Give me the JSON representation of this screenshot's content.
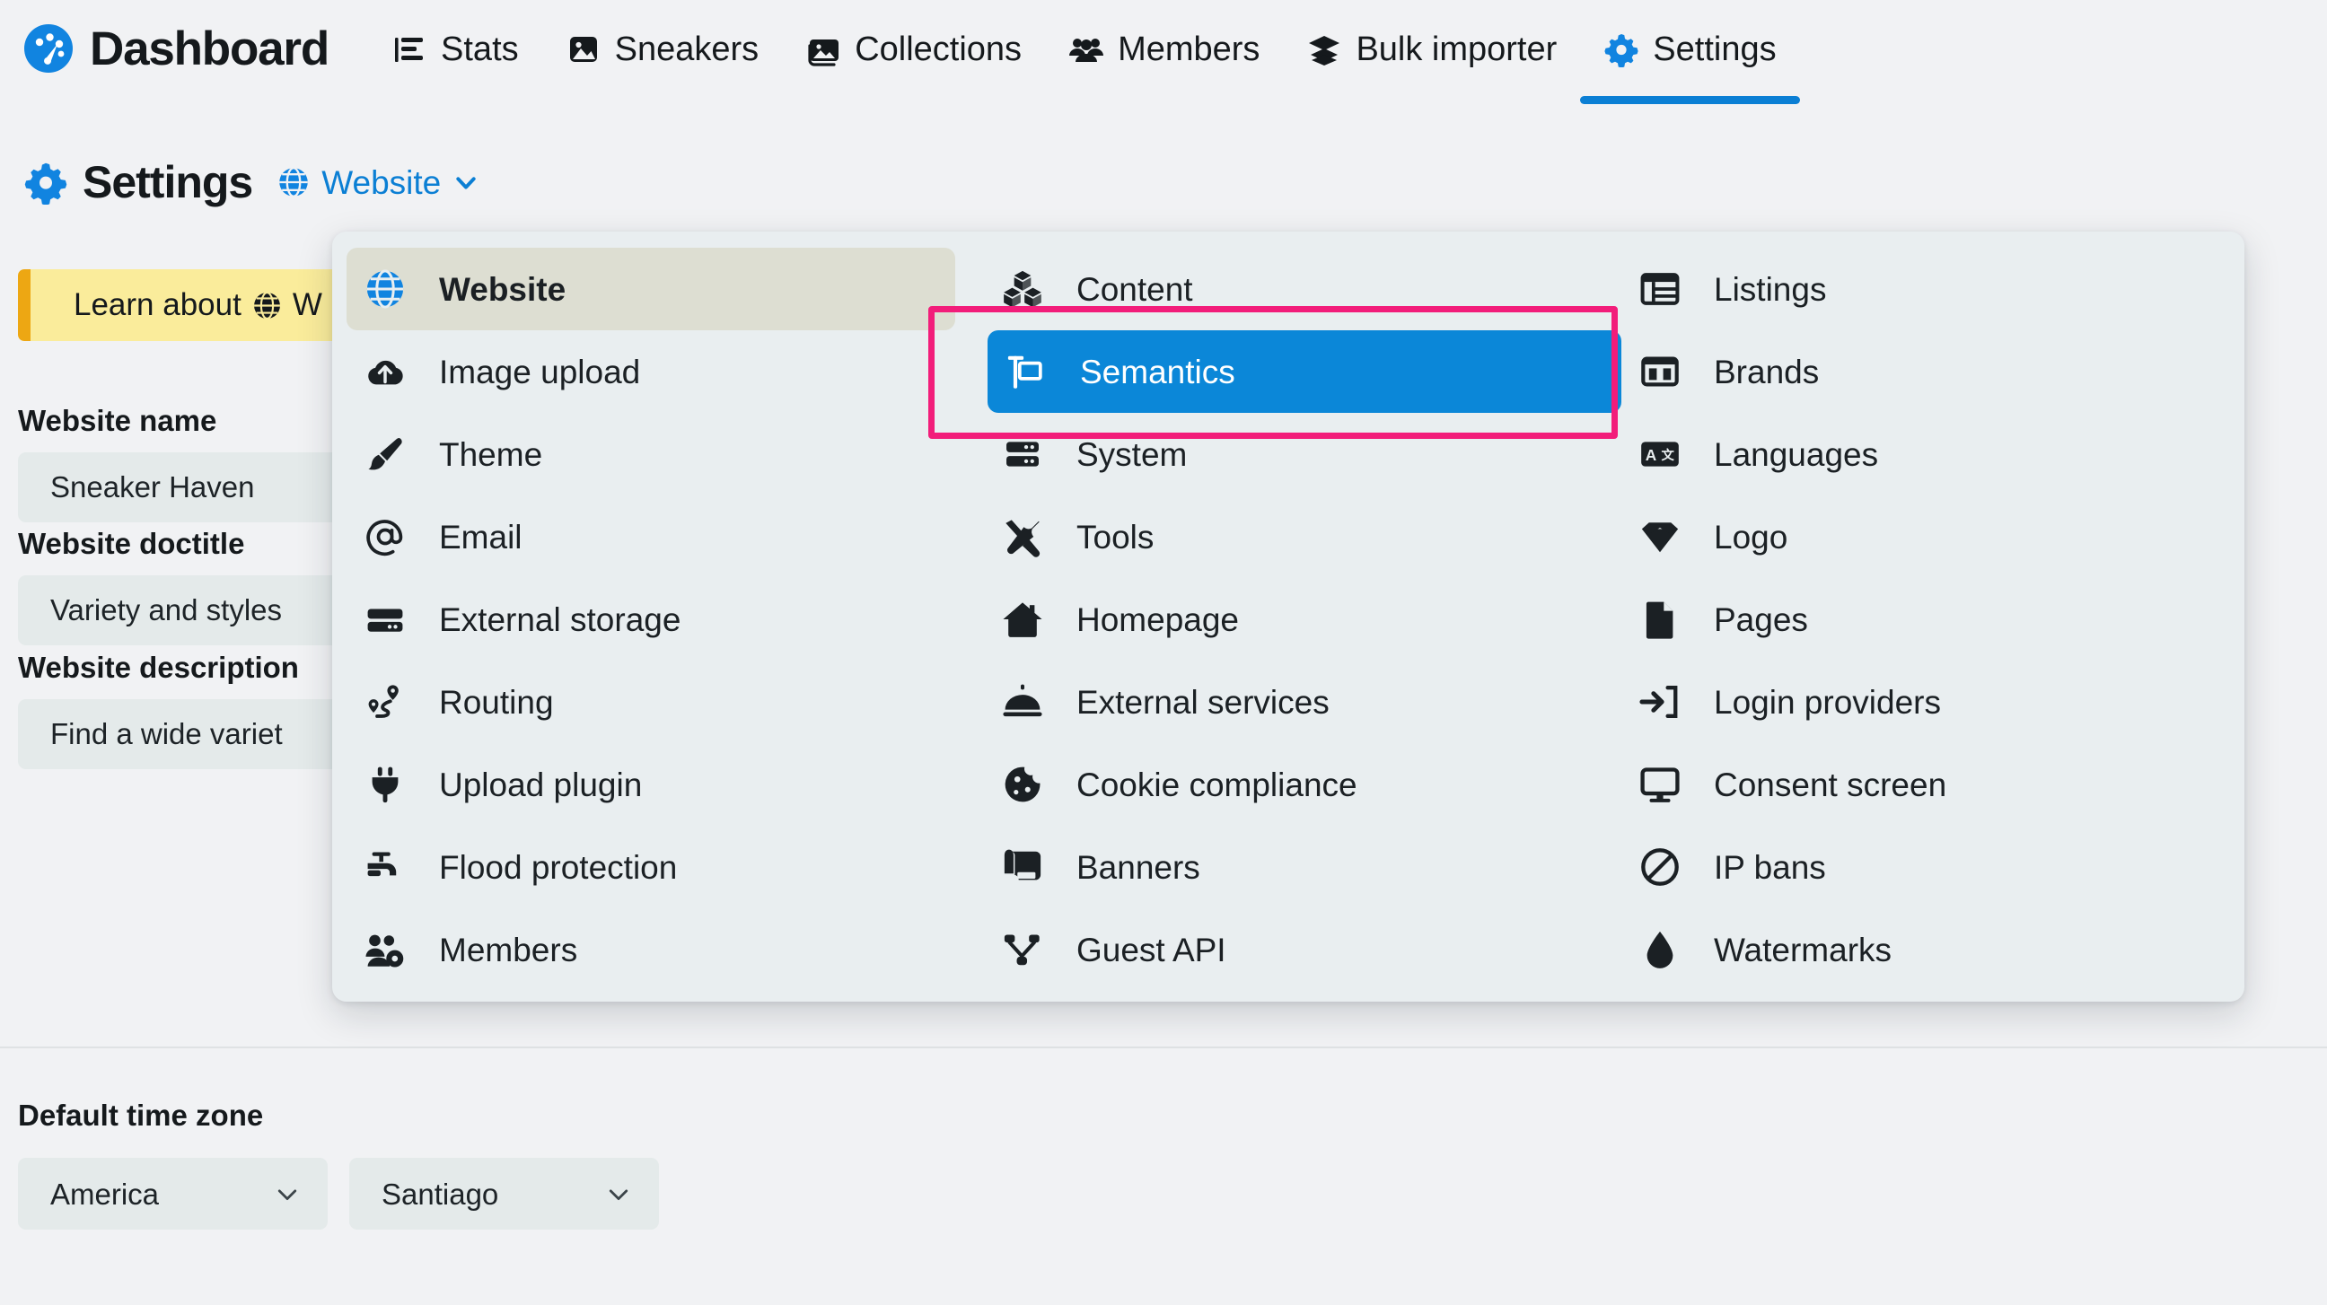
{
  "app": {
    "brand_title": "Dashboard",
    "brand_icon": "dashboard-gauge-icon"
  },
  "topnav": {
    "items": [
      {
        "label": "Stats",
        "icon": "bar-chart-icon",
        "active": false
      },
      {
        "label": "Sneakers",
        "icon": "image-icon",
        "active": false
      },
      {
        "label": "Collections",
        "icon": "photo-stack-icon",
        "active": false
      },
      {
        "label": "Members",
        "icon": "people-icon",
        "active": false
      },
      {
        "label": "Bulk importer",
        "icon": "layers-icon",
        "active": false
      },
      {
        "label": "Settings",
        "icon": "gear-icon",
        "active": true
      }
    ],
    "active_index": 5,
    "active_underline_color": "#0b7fd4"
  },
  "page_header": {
    "icon": "gear-icon",
    "title": "Settings",
    "scope": {
      "icon": "globe-icon",
      "label": "Website",
      "caret": "chevron-down-icon",
      "color": "#0b7fd4"
    }
  },
  "banner": {
    "text_before": "Learn about",
    "icon": "globe-icon",
    "text_after": "W",
    "background": "#faec9b",
    "accent": "#eda713"
  },
  "form": {
    "fields": [
      {
        "label": "Website name",
        "value": "Sneaker Haven"
      },
      {
        "label": "Website doctitle",
        "value": "Variety and styles"
      },
      {
        "label": "Website description",
        "value": "Find a wide variet"
      }
    ]
  },
  "timezone": {
    "label": "Default time zone",
    "area": {
      "value": "America",
      "caret": "chevron-down-icon"
    },
    "city": {
      "value": "Santiago",
      "caret": "chevron-down-icon"
    }
  },
  "menu": {
    "selected_label": "Website",
    "active_label": "Semantics",
    "active_color": "#0b87d8",
    "columns": [
      {
        "items": [
          {
            "label": "Website",
            "icon": "globe-icon",
            "state": "selected"
          },
          {
            "label": "Image upload",
            "icon": "cloud-upload-icon",
            "state": "normal"
          },
          {
            "label": "Theme",
            "icon": "paintbrush-icon",
            "state": "normal"
          },
          {
            "label": "Email",
            "icon": "at-sign-icon",
            "state": "normal"
          },
          {
            "label": "External storage",
            "icon": "server-icon",
            "state": "normal"
          },
          {
            "label": "Routing",
            "icon": "route-icon",
            "state": "normal"
          },
          {
            "label": "Upload plugin",
            "icon": "plug-icon",
            "state": "normal"
          },
          {
            "label": "Flood protection",
            "icon": "faucet-icon",
            "state": "normal"
          },
          {
            "label": "Members",
            "icon": "people-gear-icon",
            "state": "normal"
          }
        ]
      },
      {
        "items": [
          {
            "label": "Content",
            "icon": "boxes-icon",
            "state": "normal"
          },
          {
            "label": "Semantics",
            "icon": "flag-sign-icon",
            "state": "active"
          },
          {
            "label": "System",
            "icon": "server-rack-icon",
            "state": "normal"
          },
          {
            "label": "Tools",
            "icon": "tools-icon",
            "state": "normal"
          },
          {
            "label": "Homepage",
            "icon": "home-icon",
            "state": "normal"
          },
          {
            "label": "External services",
            "icon": "bell-service-icon",
            "state": "normal"
          },
          {
            "label": "Cookie compliance",
            "icon": "cookie-icon",
            "state": "normal"
          },
          {
            "label": "Banners",
            "icon": "banner-icon",
            "state": "normal"
          },
          {
            "label": "Guest API",
            "icon": "share-nodes-icon",
            "state": "normal"
          }
        ]
      },
      {
        "items": [
          {
            "label": "Listings",
            "icon": "table-list-icon",
            "state": "normal"
          },
          {
            "label": "Brands",
            "icon": "columns-icon",
            "state": "normal"
          },
          {
            "label": "Languages",
            "icon": "translate-icon",
            "state": "normal"
          },
          {
            "label": "Logo",
            "icon": "gem-icon",
            "state": "normal"
          },
          {
            "label": "Pages",
            "icon": "file-icon",
            "state": "normal"
          },
          {
            "label": "Login providers",
            "icon": "sign-in-icon",
            "state": "normal"
          },
          {
            "label": "Consent screen",
            "icon": "monitor-icon",
            "state": "normal"
          },
          {
            "label": "IP bans",
            "icon": "ban-icon",
            "state": "normal"
          },
          {
            "label": "Watermarks",
            "icon": "droplet-icon",
            "state": "normal"
          }
        ]
      }
    ]
  },
  "annotation": {
    "shape": "rectangle",
    "color": "#f21d7a",
    "target": "Semantics"
  }
}
